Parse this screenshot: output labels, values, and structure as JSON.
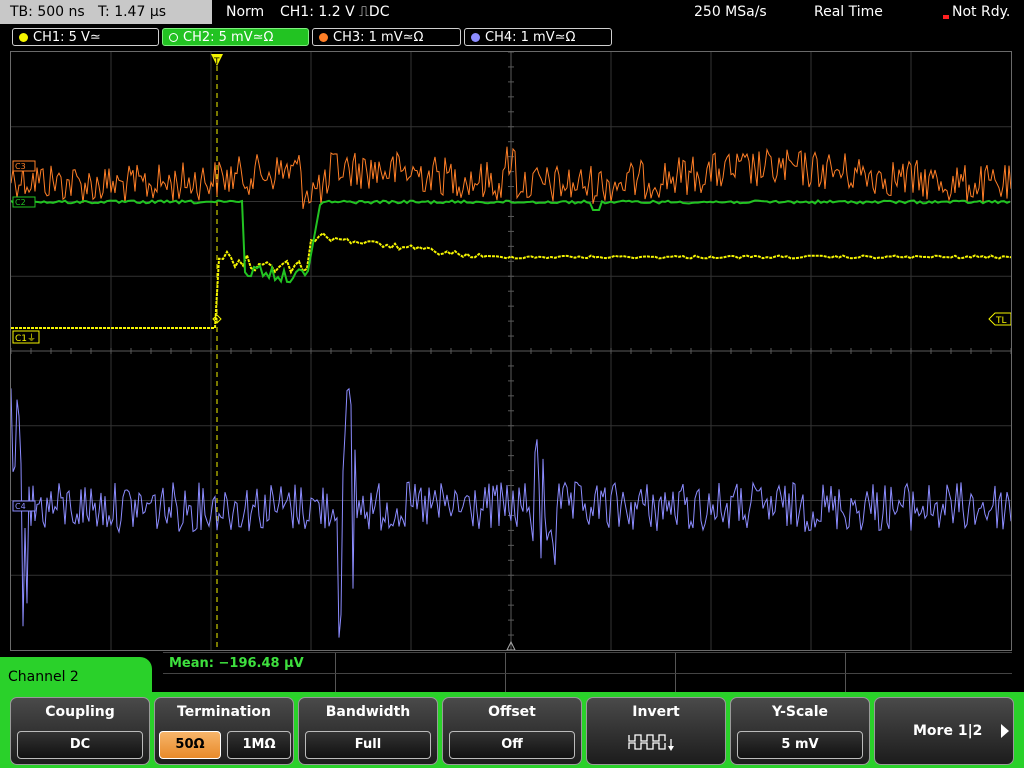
{
  "topbar": {
    "timebase": "TB: 500 ns   T: 1.47 µs",
    "trigger_mode": "Norm",
    "trigger_info": "CH1: 1.2 V ⎍DC",
    "sample_rate": "250 MSa/s",
    "acq_mode": "Real Time",
    "status": "Not Rdy."
  },
  "channels": [
    {
      "label": "CH1: 5 V≃",
      "color": "#f5f500"
    },
    {
      "label": "CH2: 5 mV≃Ω",
      "color": "#22c322"
    },
    {
      "label": "CH3: 1 mV≃Ω",
      "color": "#ff7f27"
    },
    {
      "label": "CH4: 1 mV≃Ω",
      "color": "#8c8cff"
    }
  ],
  "markers": {
    "ch1_ground": "C1⏚",
    "ch2_ground": "C2",
    "ch3_ground": "C3",
    "ch4_ground": "C4",
    "trigger_level": "TL",
    "trigger_pos": "T"
  },
  "measurement": {
    "text": "Mean: −196.48 µV"
  },
  "menu": {
    "title": "Channel 2",
    "coupling": {
      "title": "Coupling",
      "value": "DC"
    },
    "termination": {
      "title": "Termination",
      "options": [
        "50Ω",
        "1MΩ"
      ],
      "selected": "50Ω"
    },
    "bandwidth": {
      "title": "Bandwidth",
      "value": "Full"
    },
    "offset": {
      "title": "Offset",
      "value": "Off"
    },
    "invert": {
      "title": "Invert",
      "icon": "invert-waveform-icon"
    },
    "yscale": {
      "title": "Y-Scale",
      "value": "5 mV"
    },
    "more": "More 1|2"
  },
  "colors": {
    "ch1": "#f5f500",
    "ch2": "#22c322",
    "ch3": "#ff7f27",
    "ch4": "#8c8cff",
    "menu_green": "#2ad12a",
    "grid": "#3a3a3a"
  }
}
